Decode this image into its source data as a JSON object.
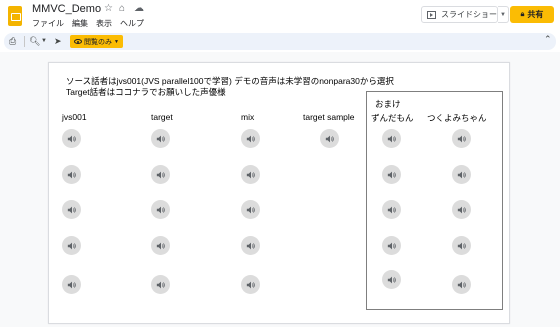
{
  "app": {
    "doc_title": "MMVC_Demo",
    "menu": [
      "ファイル",
      "編集",
      "表示",
      "ヘルプ"
    ],
    "slideshow_label": "スライドショー",
    "share_label": "共有",
    "view_only_label": "閲覧のみ"
  },
  "slide": {
    "title_line1": "ソース話者はjvs001(JVS parallel100で学習) デモの音声は未学習のnonpara30から選択",
    "title_line2": "Target話者はココナラでお願いした声優様",
    "bonus_label": "おまけ",
    "columns": [
      {
        "label": "jvs001",
        "clips": 5
      },
      {
        "label": "target",
        "clips": 5
      },
      {
        "label": "mix",
        "clips": 5
      },
      {
        "label": "target sample",
        "clips": 1
      },
      {
        "label": "ずんだもん",
        "clips": 5
      },
      {
        "label": "つくよみちゃん",
        "clips": 5
      }
    ]
  },
  "colors": {
    "brand_yellow": "#fbbc04",
    "toolbar_bg": "#edf2fa",
    "audio_button": "#dcdcdc",
    "speaker_icon": "#5f6368"
  }
}
